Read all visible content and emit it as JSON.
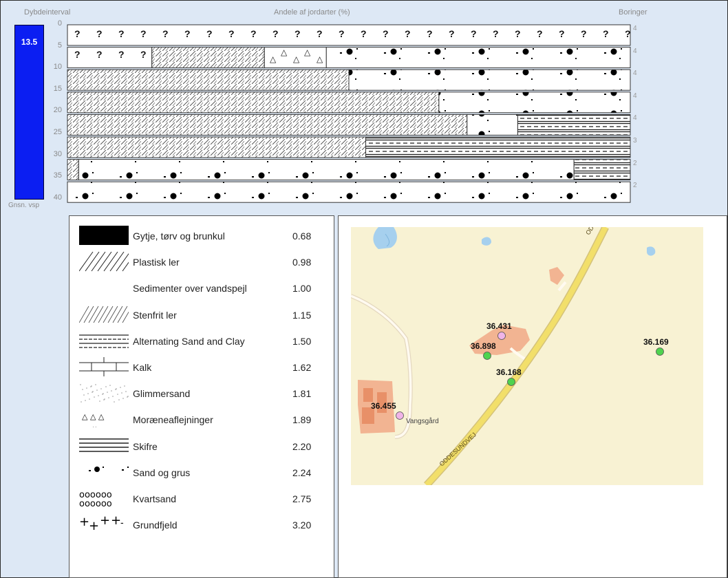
{
  "header": {
    "depth_interval": "Dybdeinterval",
    "shares": "Andele af jordarter (%)",
    "boreholes": "Boringer"
  },
  "depth_bar": {
    "value": "13.5",
    "caption": "Gnsn. vsp"
  },
  "depth_ticks": [
    "0",
    "5",
    "10",
    "15",
    "20",
    "25",
    "30",
    "35",
    "40"
  ],
  "profile_rows": [
    {
      "count": "4",
      "segments": [
        {
          "type": "unknown",
          "pct": 100
        }
      ]
    },
    {
      "count": "4",
      "segments": [
        {
          "type": "unknown",
          "pct": 15
        },
        {
          "type": "plastic",
          "pct": 20
        },
        {
          "type": "moraine",
          "pct": 11
        },
        {
          "type": "sand",
          "pct": 54
        }
      ]
    },
    {
      "count": "4",
      "segments": [
        {
          "type": "plastic",
          "pct": 50
        },
        {
          "type": "sand",
          "pct": 50
        }
      ]
    },
    {
      "count": "4",
      "segments": [
        {
          "type": "plastic",
          "pct": 66
        },
        {
          "type": "sand",
          "pct": 34
        }
      ]
    },
    {
      "count": "4",
      "segments": [
        {
          "type": "plastic",
          "pct": 71
        },
        {
          "type": "sand",
          "pct": 9
        },
        {
          "type": "alt",
          "pct": 20
        }
      ]
    },
    {
      "count": "3",
      "segments": [
        {
          "type": "plastic",
          "pct": 53
        },
        {
          "type": "alt",
          "pct": 47
        }
      ]
    },
    {
      "count": "2",
      "segments": [
        {
          "type": "plastic",
          "pct": 2
        },
        {
          "type": "sand",
          "pct": 88
        },
        {
          "type": "alt",
          "pct": 10
        }
      ]
    },
    {
      "count": "2",
      "segments": [
        {
          "type": "sand",
          "pct": 100
        }
      ]
    }
  ],
  "legend": [
    {
      "label": "Gytje, tørv og brunkul",
      "value": "0.68",
      "icon": "gytje-swatch"
    },
    {
      "label": "Plastisk ler",
      "value": "0.98",
      "icon": "plastic-clay-swatch"
    },
    {
      "label": "Sedimenter over vandspejl",
      "value": "1.00",
      "icon": "sediment-swatch"
    },
    {
      "label": "Stenfrit ler",
      "value": "1.15",
      "icon": "stonefree-clay-swatch"
    },
    {
      "label": "Alternating Sand and Clay",
      "value": "1.50",
      "icon": "alternating-swatch"
    },
    {
      "label": "Kalk",
      "value": "1.62",
      "icon": "chalk-swatch"
    },
    {
      "label": "Glimmersand",
      "value": "1.81",
      "icon": "mica-sand-swatch"
    },
    {
      "label": "Moræneaflejninger",
      "value": "1.89",
      "icon": "moraine-swatch"
    },
    {
      "label": "Skifre",
      "value": "2.20",
      "icon": "shale-swatch"
    },
    {
      "label": "Sand og grus",
      "value": "2.24",
      "icon": "sand-gravel-swatch"
    },
    {
      "label": "Kvartsand",
      "value": "2.75",
      "icon": "quartz-sand-swatch"
    },
    {
      "label": "Grundfjeld",
      "value": "3.20",
      "icon": "bedrock-swatch"
    }
  ],
  "map": {
    "road_label_top": "ODD",
    "road_label_bottom": "ODDESUNDVEJ",
    "place": "Vangsgård",
    "points": [
      {
        "label": "36.431",
        "color": "#f0b4e8"
      },
      {
        "label": "36.898",
        "color": "#4fd34f"
      },
      {
        "label": "36.168",
        "color": "#4fd34f"
      },
      {
        "label": "36.169",
        "color": "#4fd34f"
      },
      {
        "label": "36.455",
        "color": "#f0b4e8"
      }
    ]
  }
}
